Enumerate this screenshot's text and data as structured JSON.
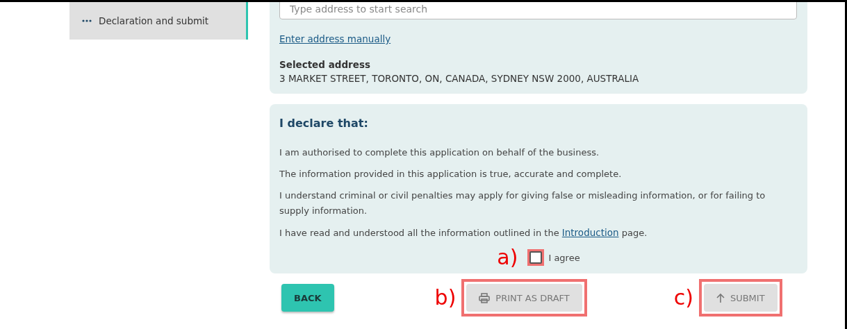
{
  "sidebar": {
    "items": [
      {
        "label": "Declaration and submit",
        "selected": true
      }
    ]
  },
  "address": {
    "search": {
      "placeholder": "Type address to start search"
    },
    "manual_link": "Enter address manually",
    "selected_label": "Selected address",
    "selected_value": "3 MARKET STREET, TORONTO, ON, CANADA, SYDNEY NSW 2000, AUSTRALIA"
  },
  "declaration": {
    "heading": "I declare that:",
    "statements": [
      {
        "text": "I am authorised to complete this application on behalf of the business."
      },
      {
        "text": "The information provided in this application is true, accurate and complete."
      },
      {
        "text": "I understand criminal or civil penalties may apply for giving false or misleading information, or for failing to supply information."
      },
      {
        "text": "I have read and understood all the information outlined in the",
        "link": "Introduction",
        "after": "page."
      }
    ],
    "agree": {
      "label": "I agree",
      "checked": false,
      "annotation": "a)",
      "highlighted": true
    }
  },
  "buttons": [
    {
      "kind": "back",
      "label": "BACK",
      "disabled": false,
      "highlighted": false
    },
    {
      "kind": "print",
      "label": "PRINT AS DRAFT",
      "disabled": true,
      "annotation": "b)",
      "highlighted": true
    },
    {
      "kind": "submit",
      "label": "SUBMIT",
      "disabled": true,
      "annotation": "c)",
      "highlighted": true
    }
  ]
}
